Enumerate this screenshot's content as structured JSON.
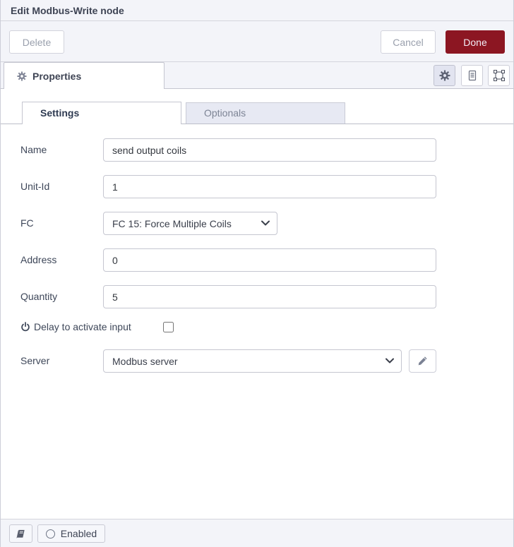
{
  "dialog": {
    "title": "Edit Modbus-Write node"
  },
  "header": {
    "delete_label": "Delete",
    "cancel_label": "Cancel",
    "done_label": "Done"
  },
  "tray": {
    "properties_tab_label": "Properties",
    "icon_buttons": [
      "gear-icon",
      "document-icon",
      "appearance-icon"
    ]
  },
  "form_tabs": {
    "settings_label": "Settings",
    "optionals_label": "Optionals"
  },
  "fields": {
    "name": {
      "label": "Name",
      "value": "send output coils"
    },
    "unit_id": {
      "label": "Unit-Id",
      "value": "1"
    },
    "fc": {
      "label": "FC",
      "selected_option": "FC 15: Force Multiple Coils"
    },
    "address": {
      "label": "Address",
      "value": "0"
    },
    "quantity": {
      "label": "Quantity",
      "value": "5"
    },
    "delay_to_activate": {
      "label": "Delay to activate input",
      "checked": false
    },
    "server": {
      "label": "Server",
      "selected_option": "Modbus server"
    }
  },
  "footer": {
    "enabled_label": "Enabled"
  },
  "colors": {
    "done_button_bg": "#8C1622",
    "page_bg": "#f3f4f9",
    "panel_bg": "#ffffff",
    "inactive_tab_bg": "#e7e9f3",
    "active_tab_text": "#2f3b52",
    "muted_text": "#9aa0ad"
  }
}
